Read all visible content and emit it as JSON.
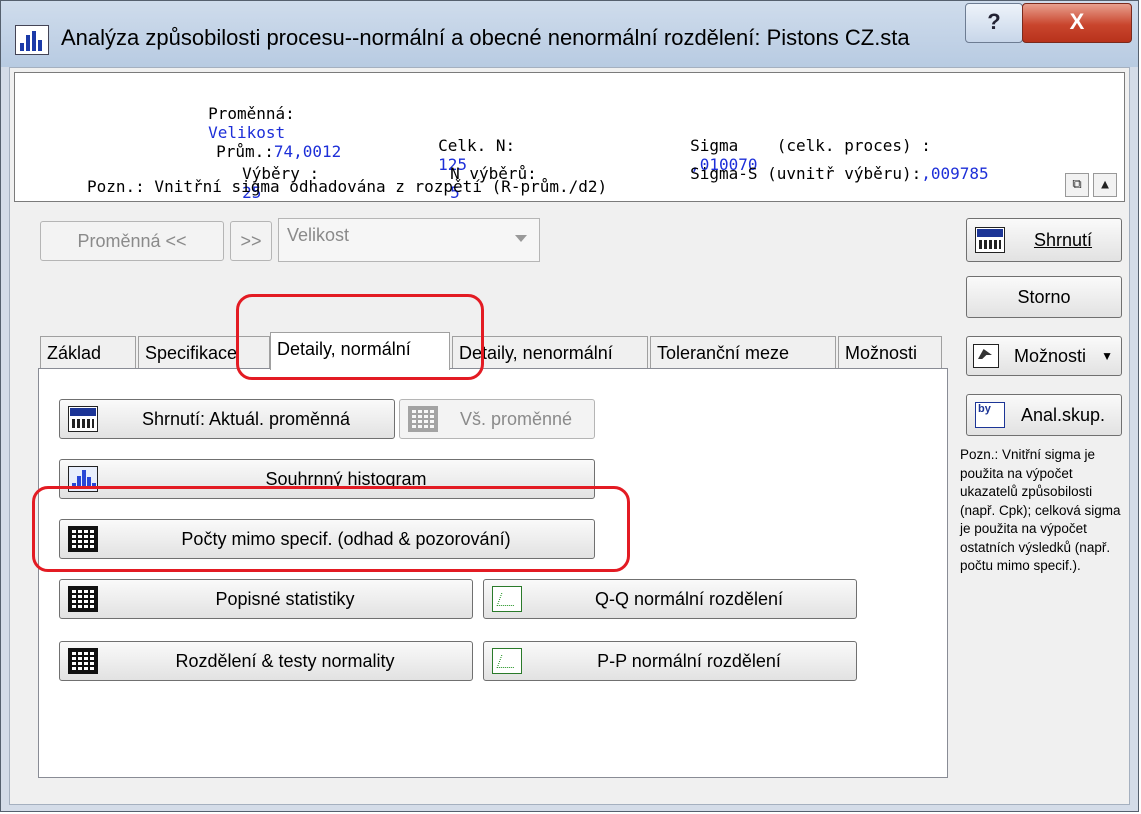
{
  "window": {
    "title": "Analýza způsobilosti procesu--normální a obecné nenormální rozdělení: Pistons CZ.sta",
    "help_label": "?",
    "close_label": "X"
  },
  "summary": {
    "promenna_label": "Proměnná:",
    "promenna_value": "Velikost",
    "prum_label": "Prům.:",
    "prum_value": "74,0012",
    "celk_n_label": "Celk. N:",
    "celk_n_value": "125",
    "sigma_label": "Sigma    (celk. proces) :",
    "sigma_value": ",010070",
    "vybery_label": "Výběry :",
    "vybery_value": "25",
    "n_vyberu_label": "N výběrů:",
    "n_vyberu_value": "5",
    "sigma_s_label": "Sigma-S (uvnitř výběru):",
    "sigma_s_value": ",009785",
    "pozn_text": "Pozn.: Vnitřní sigma odhadována z rozpětí (R-prům./d2)"
  },
  "variable_nav": {
    "prev_label": "Proměnná <<",
    "next_label": ">>",
    "combo_value": "Velikost"
  },
  "right_buttons": {
    "shrnuti": "Shrnutí",
    "storno": "Storno",
    "moznosti": "Možnosti",
    "anal_skup": "Anal.skup."
  },
  "tabs": [
    {
      "label": "Základ"
    },
    {
      "label": "Specifikace"
    },
    {
      "label": "Detaily, normální"
    },
    {
      "label": "Detaily, nenormální"
    },
    {
      "label": "Toleranční meze"
    },
    {
      "label": "Možnosti"
    }
  ],
  "panel_buttons": {
    "shrnuti_aktual": "Shrnutí: Aktuál. proměnná",
    "vs_promenne": "Vš. proměnné",
    "souhrnny_histogram": "Souhrnný histogram",
    "pocty_mimo": "Počty mimo specif. (odhad & pozorování)",
    "popisne_statistiky": "Popisné statistiky",
    "qq": "Q-Q normální rozdělení",
    "rozdeleni_testy": "Rozdělení & testy normality",
    "pp": "P-P normální rozdělení"
  },
  "note": "Pozn.: Vnitřní sigma je použita na výpočet ukazatelů způsobilosti (např. Cpk); celková sigma je použita na výpočet ostatních výsledků (např. počtu mimo specif.).",
  "colors": {
    "value_blue": "#1d2fd8",
    "highlight_red": "#e31b23",
    "close_red": "#c9452d"
  }
}
